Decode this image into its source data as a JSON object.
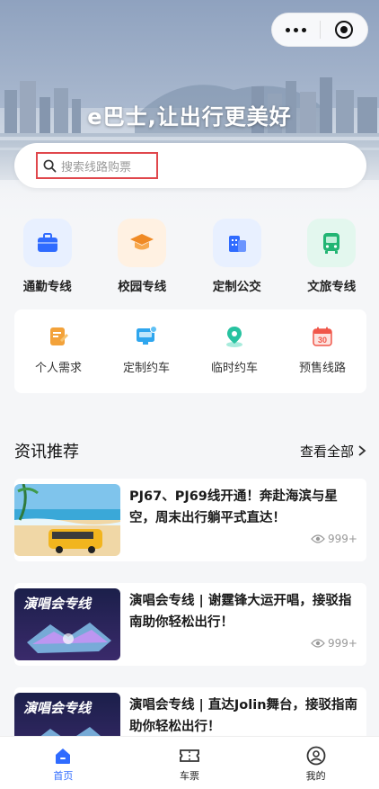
{
  "header": {
    "slogan": "e巴士,让出行更美好",
    "search_placeholder": "搜索线路购票"
  },
  "categories": [
    {
      "label": "通勤专线",
      "icon": "briefcase-icon",
      "color": "#2f6bff",
      "bg": "#e8f0ff"
    },
    {
      "label": "校园专线",
      "icon": "graduation-cap-icon",
      "color": "#f08a24",
      "bg": "#fff1e2"
    },
    {
      "label": "定制公交",
      "icon": "building-icon",
      "color": "#2f6bff",
      "bg": "#e8f0ff"
    },
    {
      "label": "文旅专线",
      "icon": "bus-icon",
      "color": "#22b573",
      "bg": "#e3f7ee"
    }
  ],
  "services": [
    {
      "label": "个人需求",
      "icon": "note-icon",
      "color": "#f3a23a"
    },
    {
      "label": "定制约车",
      "icon": "monitor-car-icon",
      "color": "#2fa6ee"
    },
    {
      "label": "临时约车",
      "icon": "location-pin-icon",
      "color": "#27c2a0"
    },
    {
      "label": "预售线路",
      "icon": "calendar-30-icon",
      "color": "#f0574a",
      "badge": "30"
    }
  ],
  "news": {
    "title": "资讯推荐",
    "more": "查看全部",
    "items": [
      {
        "title": "PJ67、PJ69线开通！奔赴海滨与星空，周末出行躺平式直达！",
        "views": "999+"
      },
      {
        "title": "演唱会专线 | 谢霆锋大运开唱，接驳指南助你轻松出行！",
        "views": "999+",
        "thumb_text": "演唱会专线"
      },
      {
        "title": "演唱会专线 | 直达Jolin舞台，接驳指南助你轻松出行！",
        "views": "",
        "thumb_text": "演唱会专线"
      }
    ]
  },
  "tabbar": [
    {
      "label": "首页",
      "icon": "home-icon",
      "active": true
    },
    {
      "label": "车票",
      "icon": "ticket-icon",
      "active": false
    },
    {
      "label": "我的",
      "icon": "profile-icon",
      "active": false
    }
  ]
}
